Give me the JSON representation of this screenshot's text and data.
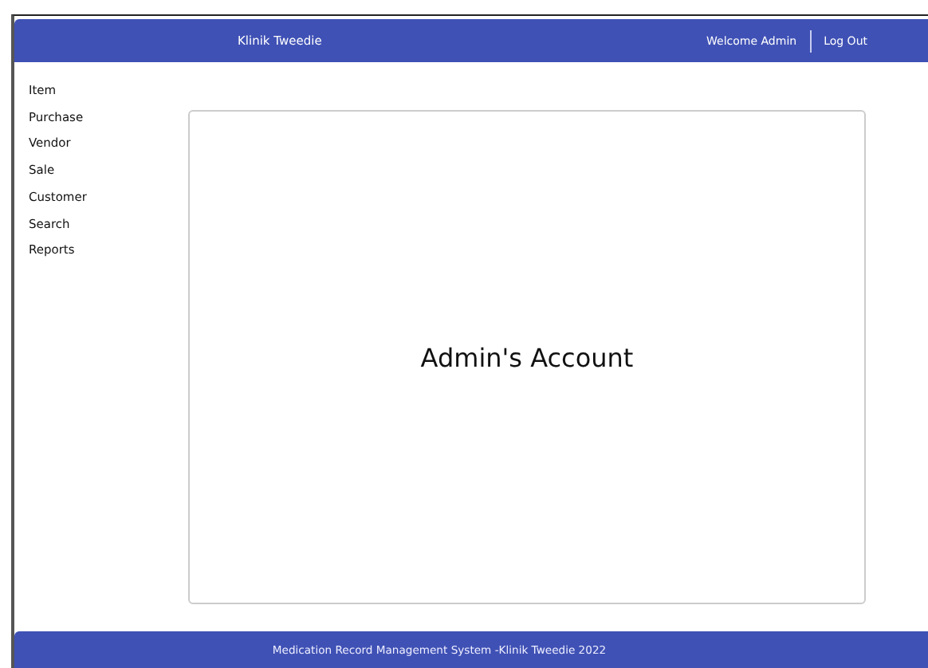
{
  "header": {
    "title": "Klinik Tweedie",
    "welcome": "Welcome Admin",
    "logout": "Log Out"
  },
  "sidebar": {
    "items": [
      "Item",
      "Purchase",
      "Vendor",
      "Sale",
      "Customer",
      "Search",
      "Reports"
    ]
  },
  "content": {
    "heading": "Admin's Account"
  },
  "footer": {
    "text": "Medication Record Management System -Klinik Tweedie 2022"
  }
}
